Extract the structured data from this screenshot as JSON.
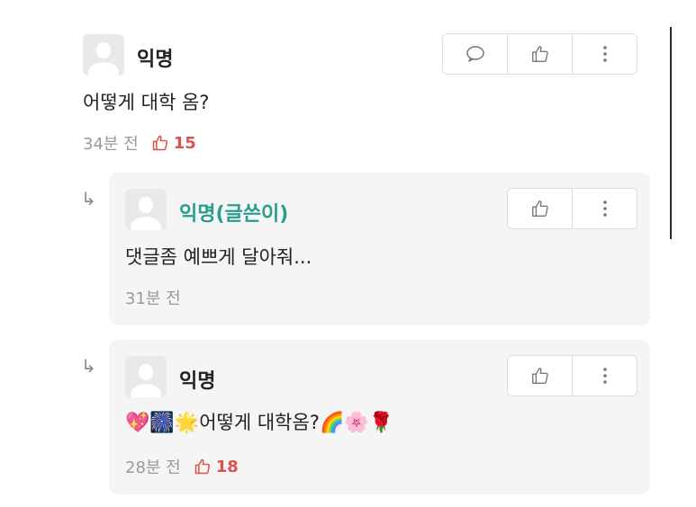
{
  "post": {
    "author": "익명",
    "content": "어떻게 대학 옴?",
    "time": "34분 전",
    "likes": "15"
  },
  "replies": [
    {
      "author": "익명(글쓴이)",
      "content": "댓글좀 예쁘게 달아줘...",
      "time": "31분 전"
    },
    {
      "author": "익명",
      "emoji_prefix": "💖🎆🌟",
      "content": "어떻게 대학옴?",
      "emoji_suffix": "🌈🌸🌹",
      "time": "28분 전",
      "likes": "18"
    }
  ],
  "icons": {
    "comment": "comment-icon",
    "like": "thumbs-up-icon",
    "more": "more-vertical-icon",
    "reply": "reply-arrow-icon",
    "avatar": "avatar-icon"
  },
  "colors": {
    "like": "#d9534f",
    "author_highlight": "#2a9d8f",
    "reply_background": "#f5f5f5"
  }
}
